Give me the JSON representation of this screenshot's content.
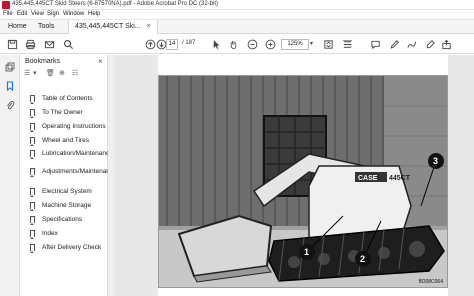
{
  "window": {
    "title": "435,445,445CT Skid Steers (6-87570NA).pdf - Adobe Acrobat Pro DC (32-bit)"
  },
  "menu": [
    "File",
    "Edit",
    "View",
    "Sign",
    "Window",
    "Help"
  ],
  "tabs": {
    "home": "Home",
    "tools": "Tools",
    "document": "435,445,445CT Ski...",
    "close": "×"
  },
  "toolbar": {
    "page_current": "14",
    "page_total": "/ 187",
    "zoom": "125%",
    "zoom_arrow": "▾"
  },
  "bookmarks": {
    "title": "Bookmarks",
    "close": "×",
    "items": [
      "Table of Contents",
      "To The Owner",
      "Operating Instructions",
      "Wheel and Tires",
      "Lubrication/Maintenance",
      "Adjustments/Maintenance",
      "Electrical System",
      "Machine Storage",
      "Specifications",
      "Index",
      "After Delivery Check"
    ]
  },
  "photo": {
    "code": "BD08C064",
    "brand": "CASE",
    "model": "445CT",
    "callout_1": "1",
    "callout_2": "2",
    "callout_3": "3"
  }
}
